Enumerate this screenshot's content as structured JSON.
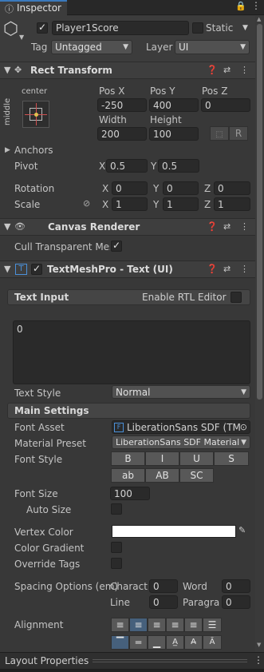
{
  "tab": {
    "label": "Inspector"
  },
  "object": {
    "name": "Player1Score",
    "static_label": "Static",
    "tag_label": "Tag",
    "tag_value": "Untagged",
    "layer_label": "Layer",
    "layer_value": "UI"
  },
  "rect_transform": {
    "title": "Rect Transform",
    "anchor_label_top": "center",
    "anchor_label_side": "middle",
    "posx_label": "Pos X",
    "posy_label": "Pos Y",
    "posz_label": "Pos Z",
    "posx": "-250",
    "posy": "400",
    "posz": "0",
    "width_label": "Width",
    "height_label": "Height",
    "width": "200",
    "height": "100",
    "r_button": "R",
    "anchors": "Anchors",
    "pivot_label": "Pivot",
    "pivot_x": "0.5",
    "pivot_y": "0.5",
    "rotation_label": "Rotation",
    "rot_x": "0",
    "rot_y": "0",
    "rot_z": "0",
    "scale_label": "Scale",
    "scale_x": "1",
    "scale_y": "1",
    "scale_z": "1",
    "x": "X",
    "y": "Y",
    "z": "Z"
  },
  "canvas_renderer": {
    "title": "Canvas Renderer",
    "cull_label": "Cull Transparent Mes"
  },
  "tmp": {
    "title": "TextMeshPro - Text (UI)",
    "text_input": "Text Input",
    "rtl_label": "Enable RTL Editor",
    "text_value": "0",
    "text_style_label": "Text Style",
    "text_style_value": "Normal",
    "main_settings": "Main Settings",
    "font_asset_label": "Font Asset",
    "font_asset_value": "LiberationSans SDF (TMI",
    "material_preset_label": "Material Preset",
    "material_preset_value": "LiberationSans SDF Material",
    "font_style_label": "Font Style",
    "style_buttons_row1": [
      "B",
      "I",
      "U",
      "S"
    ],
    "style_buttons_row2": [
      "ab",
      "AB",
      "SC"
    ],
    "font_size_label": "Font Size",
    "font_size_value": "100",
    "auto_size_label": "Auto Size",
    "vertex_color_label": "Vertex Color",
    "color_gradient_label": "Color Gradient",
    "override_tags_label": "Override Tags",
    "spacing_label": "Spacing Options (em)",
    "character_label": "Characte",
    "character_value": "0",
    "word_label": "Word",
    "word_value": "0",
    "line_label": "Line",
    "line_value": "0",
    "paragraph_label": "Paragrap",
    "paragraph_value": "0",
    "alignment_label": "Alignment"
  },
  "footer": {
    "title": "Layout Properties"
  },
  "colors": {
    "background": "#383838",
    "header": "#3e3e3e",
    "field": "#2a2a2a",
    "selected": "#46607c",
    "white": "#ffffff"
  }
}
